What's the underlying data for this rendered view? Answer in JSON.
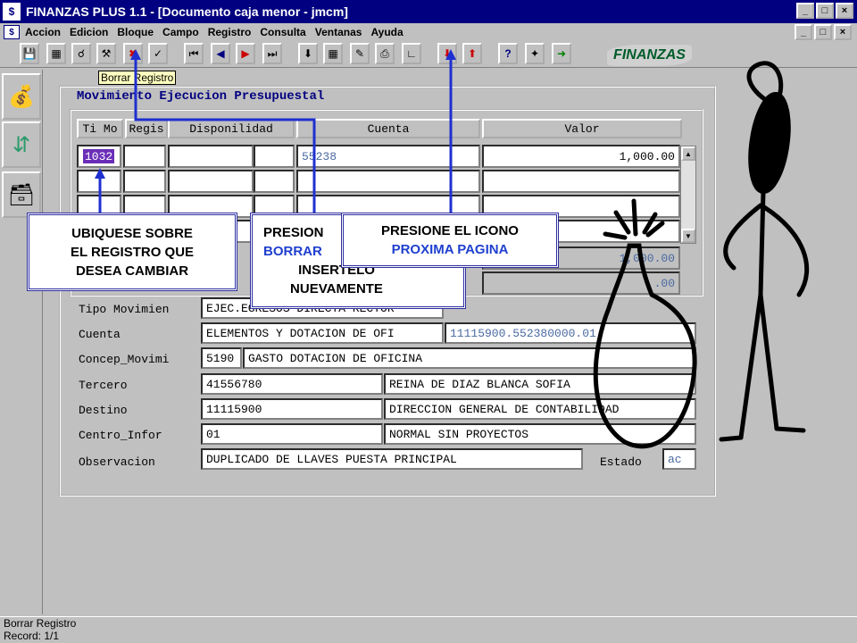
{
  "app": {
    "title": "FINANZAS PLUS 1.1 - [Documento caja menor - jmcm]",
    "window_buttons": [
      "_",
      "□",
      "×"
    ]
  },
  "menu": {
    "items": [
      "Accion",
      "Edicion",
      "Bloque",
      "Campo",
      "Registro",
      "Consulta",
      "Ventanas",
      "Ayuda"
    ]
  },
  "toolbar": {
    "tooltip": "Borrar Registro",
    "logo_text": "FINANZAS"
  },
  "panel": {
    "title": "Movimiento Ejecucion Presupuestal",
    "columns": [
      "Ti Mo",
      "Regis",
      "Disponilidad",
      "Cuenta",
      "Valor"
    ],
    "rows": [
      {
        "ti_mo": "1032",
        "regis": "",
        "disp": "",
        "disp2": "",
        "cuenta": "55238",
        "valor": "1,000.00"
      },
      {
        "ti_mo": "",
        "regis": "",
        "disp": "",
        "disp2": "",
        "cuenta": "",
        "valor": ""
      },
      {
        "ti_mo": "",
        "regis": "",
        "disp": "",
        "disp2": "",
        "cuenta": "",
        "valor": ""
      },
      {
        "ti_mo": "",
        "regis": "",
        "disp": "",
        "disp2": "",
        "cuenta": "",
        "valor": ""
      }
    ],
    "extra_valor_1": "1,000.00",
    "extra_valor_2": ".00"
  },
  "form": {
    "tipo_label": "Tipo Movimien",
    "tipo_value": "EJEC.EGRESOS DIRECTA RECTOR",
    "cuenta_label": "Cuenta",
    "cuenta_value": "ELEMENTOS Y DOTACION DE OFI",
    "cuenta_code": "11115900.552380000.01",
    "concep_label": "Concep_Movimi",
    "concep_code": "5190",
    "concep_value": "GASTO DOTACION DE OFICINA",
    "tercero_label": "Tercero",
    "tercero_code": "41556780",
    "tercero_value": "REINA DE DIAZ BLANCA SOFIA",
    "destino_label": "Destino",
    "destino_code": "11115900",
    "destino_value": "DIRECCION GENERAL DE CONTABILIDAD",
    "centro_label": "Centro_Infor",
    "centro_code": "01",
    "centro_value": "NORMAL SIN PROYECTOS",
    "obs_label": "Observacion",
    "obs_value": "DUPLICADO DE LLAVES PUESTA PRINCIPAL",
    "estado_label": "Estado",
    "estado_value": "ac"
  },
  "callouts": {
    "c1": [
      "UBIQUESE SOBRE",
      "EL REGISTRO QUE",
      "DESEA CAMBIAR"
    ],
    "c2_line1": "PRESION",
    "c2_line2": "BORRAR",
    "c2_line3": "INSERTELO",
    "c2_line4": "NUEVAMENTE",
    "c3_line1": "PRESIONE EL ICONO",
    "c3_line2": "PROXIMA PAGINA"
  },
  "status": {
    "line1": "Borrar Registro",
    "line2": "Record: 1/1"
  },
  "colors": {
    "title_bg": "#000080",
    "selected_cell": "#6a2eb8",
    "arrow": "#1f2fd0"
  }
}
